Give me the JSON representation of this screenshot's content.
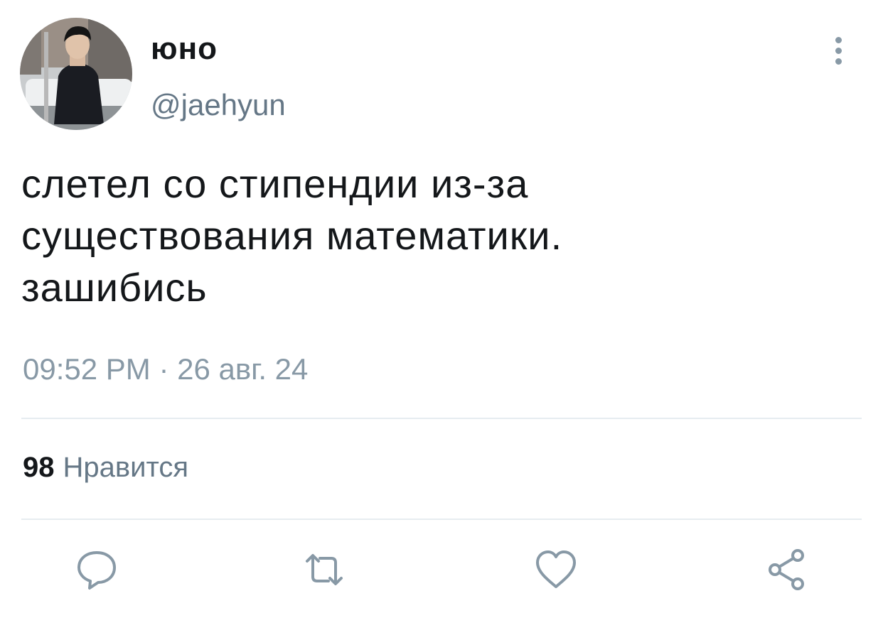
{
  "author": {
    "display_name": "юно",
    "handle": "@jaehyun"
  },
  "tweet": {
    "text_lines": [
      "слетел со стипендии из-за",
      "существования математики.",
      "зашибись"
    ],
    "timestamp": "09:52 PM · 26 авг. 24"
  },
  "stats": {
    "likes_count": "98",
    "likes_label": "Нравится"
  },
  "actions": {
    "reply_icon": "speech-bubble-icon",
    "retweet_icon": "retweet-icon",
    "like_icon": "heart-icon",
    "share_icon": "share-icon"
  },
  "colors": {
    "text_primary": "#14171a",
    "text_secondary": "#657786",
    "icon_gray": "#8899a6",
    "divider": "#e6ecf0"
  }
}
